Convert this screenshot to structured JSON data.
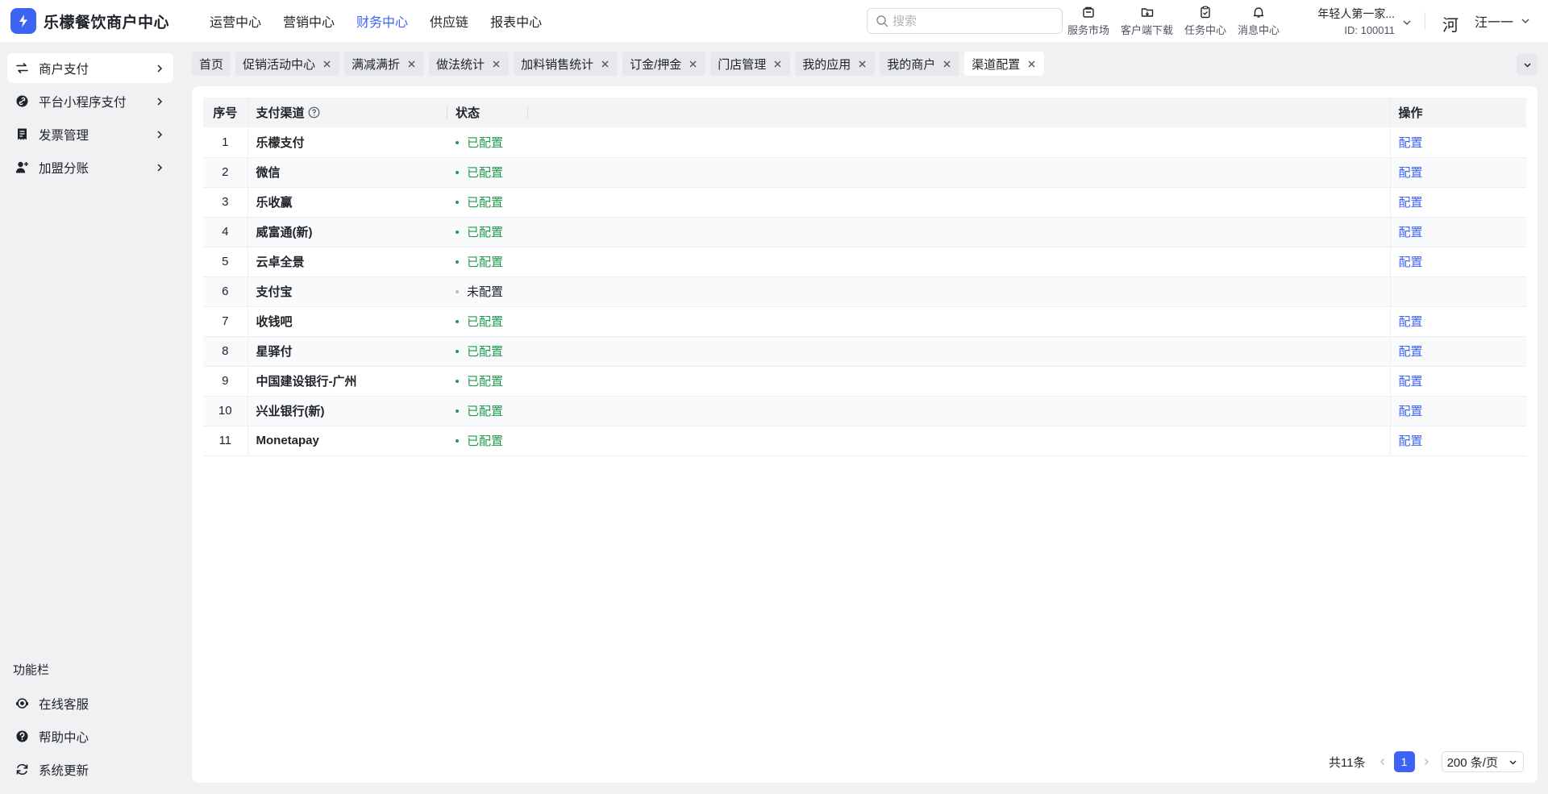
{
  "brand": {
    "name": "乐檬餐饮商户中心",
    "accent": "#3d63f5"
  },
  "topnav": [
    {
      "label": "运营中心",
      "active": false
    },
    {
      "label": "营销中心",
      "active": false
    },
    {
      "label": "财务中心",
      "active": true
    },
    {
      "label": "供应链",
      "active": false
    },
    {
      "label": "报表中心",
      "active": false
    }
  ],
  "search": {
    "placeholder": "搜索"
  },
  "tools": [
    {
      "label": "服务市场",
      "icon": "store-icon"
    },
    {
      "label": "客户端下载",
      "icon": "download-folder-icon"
    },
    {
      "label": "任务中心",
      "icon": "clipboard-icon"
    },
    {
      "label": "消息中心",
      "icon": "bell-icon"
    }
  ],
  "account": {
    "name": "年轻人第一家...",
    "id": "ID: 100011"
  },
  "user": {
    "avatar_char": "河",
    "name": "汪一一"
  },
  "sidebar": {
    "items": [
      {
        "label": "商户支付",
        "icon": "exchange-icon",
        "active": true
      },
      {
        "label": "平台小程序支付",
        "icon": "link-icon",
        "active": false
      },
      {
        "label": "发票管理",
        "icon": "invoice-icon",
        "active": false
      },
      {
        "label": "加盟分账",
        "icon": "user-plus-icon",
        "active": false
      }
    ],
    "function_title": "功能栏",
    "function_items": [
      {
        "label": "在线客服",
        "icon": "headset-icon"
      },
      {
        "label": "帮助中心",
        "icon": "help-icon"
      },
      {
        "label": "系统更新",
        "icon": "refresh-icon"
      }
    ]
  },
  "tabs": [
    {
      "label": "首页",
      "closable": false,
      "active": false
    },
    {
      "label": "促销活动中心",
      "closable": true,
      "active": false
    },
    {
      "label": "满减满折",
      "closable": true,
      "active": false
    },
    {
      "label": "做法统计",
      "closable": true,
      "active": false
    },
    {
      "label": "加料销售统计",
      "closable": true,
      "active": false
    },
    {
      "label": "订金/押金",
      "closable": true,
      "active": false
    },
    {
      "label": "门店管理",
      "closable": true,
      "active": false
    },
    {
      "label": "我的应用",
      "closable": true,
      "active": false
    },
    {
      "label": "我的商户",
      "closable": true,
      "active": false
    },
    {
      "label": "渠道配置",
      "closable": true,
      "active": true
    }
  ],
  "table": {
    "columns": {
      "index": "序号",
      "channel": "支付渠道",
      "status": "状态",
      "action": "操作"
    },
    "rows": [
      {
        "index": "1",
        "channel": "乐檬支付",
        "status": "已配置",
        "configured": true,
        "action": "配置"
      },
      {
        "index": "2",
        "channel": "微信",
        "status": "已配置",
        "configured": true,
        "action": "配置"
      },
      {
        "index": "3",
        "channel": "乐收赢",
        "status": "已配置",
        "configured": true,
        "action": "配置"
      },
      {
        "index": "4",
        "channel": "威富通(新)",
        "status": "已配置",
        "configured": true,
        "action": "配置"
      },
      {
        "index": "5",
        "channel": "云卓全景",
        "status": "已配置",
        "configured": true,
        "action": "配置"
      },
      {
        "index": "6",
        "channel": "支付宝",
        "status": "未配置",
        "configured": false,
        "action": ""
      },
      {
        "index": "7",
        "channel": "收钱吧",
        "status": "已配置",
        "configured": true,
        "action": "配置"
      },
      {
        "index": "8",
        "channel": "星驿付",
        "status": "已配置",
        "configured": true,
        "action": "配置"
      },
      {
        "index": "9",
        "channel": "中国建设银行-广州",
        "status": "已配置",
        "configured": true,
        "action": "配置"
      },
      {
        "index": "10",
        "channel": "兴业银行(新)",
        "status": "已配置",
        "configured": true,
        "action": "配置"
      },
      {
        "index": "11",
        "channel": "Monetapay",
        "status": "已配置",
        "configured": true,
        "action": "配置"
      }
    ]
  },
  "pagination": {
    "total": "共11条",
    "current": "1",
    "page_size": "200 条/页"
  }
}
